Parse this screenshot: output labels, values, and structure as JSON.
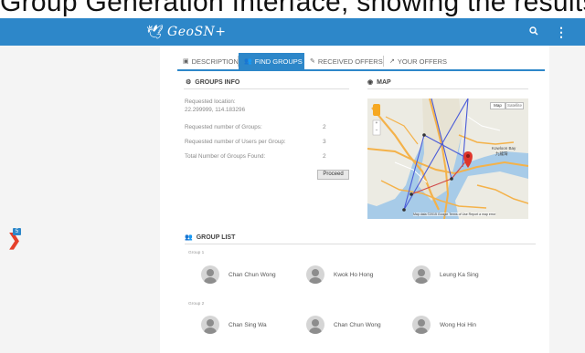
{
  "caption": "Group Generation Interface, showing the results of a",
  "app": {
    "brand": "GeoSN+",
    "colors": {
      "primary": "#2d87c9",
      "accent": "#e5402a"
    }
  },
  "sidebar": {
    "badge_count": "5"
  },
  "tabs": [
    {
      "label": "DESCRIPTION",
      "icon": "image-icon"
    },
    {
      "label": "FIND GROUPS",
      "icon": "users-icon",
      "active": true
    },
    {
      "label": "RECEIVED OFFERS",
      "icon": "edit-icon"
    },
    {
      "label": "YOUR OFFERS",
      "icon": "share-icon"
    }
  ],
  "groups_info": {
    "title": "GROUPS INFO",
    "location_label": "Requested location:",
    "location_value": "22.299999, 114.183296",
    "rows": [
      {
        "label": "Requested number of Groups:",
        "value": "2"
      },
      {
        "label": "Requested number of Users per Group:",
        "value": "3"
      },
      {
        "label": "Total Number of Groups Found:",
        "value": "2"
      }
    ],
    "proceed_label": "Proceed"
  },
  "map": {
    "title": "MAP",
    "type_buttons": [
      "Map",
      "Satellite"
    ],
    "zoom_in": "+",
    "zoom_out": "−",
    "place_label": "Kowloon Bay",
    "place_label_zh": "九龍灣",
    "attribution": "Map data ©2015 Google   Terms of Use   Report a map error"
  },
  "group_list": {
    "title": "GROUP LIST",
    "groups": [
      {
        "label": "Group 1",
        "members": [
          "Chan Chun Wong",
          "Kwok Ho Hong",
          "Leung Ka Sing"
        ]
      },
      {
        "label": "Group 2",
        "members": [
          "Chan Sing Wa",
          "Chan Chun Wong",
          "Wong Hoi Hin"
        ]
      }
    ]
  }
}
